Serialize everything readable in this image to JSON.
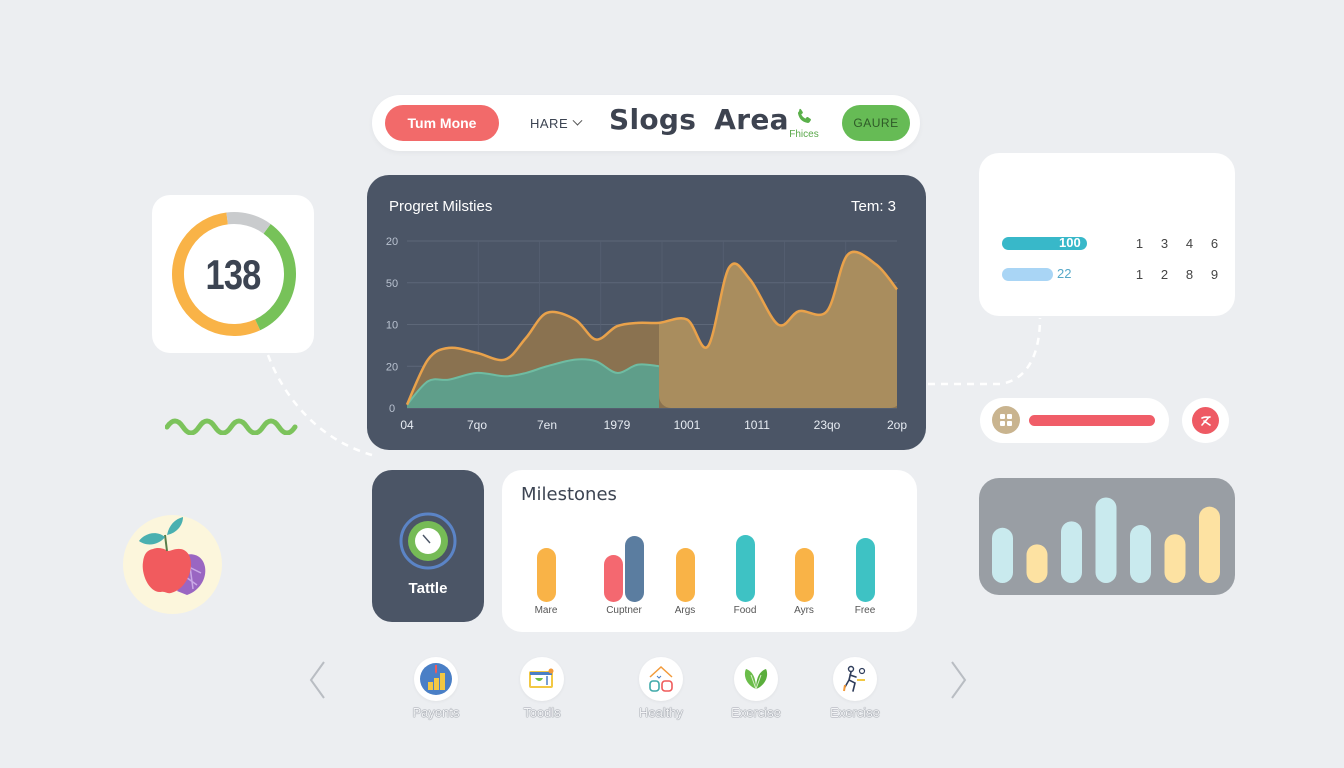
{
  "topbar": {
    "primary_button": "Tum Mone",
    "dropdown_label": "HARE",
    "title": "Slogs Area",
    "phone_label": "Fhices",
    "secondary_button": "GAURE"
  },
  "gauge": {
    "value": "138",
    "segments": [
      {
        "name": "orange",
        "fraction": 0.55,
        "color": "#f9b347"
      },
      {
        "name": "green",
        "fraction": 0.33,
        "color": "#77c259"
      },
      {
        "name": "gray",
        "fraction": 0.12,
        "color": "#c9cbcd"
      }
    ]
  },
  "main_chart": {
    "title": "Progret Milsties",
    "meta": "Tem: 3"
  },
  "chart_data": {
    "type": "area",
    "title": "Progret Milsties",
    "y_tick_labels": [
      "0",
      "20",
      "10",
      "50",
      "20"
    ],
    "x_tick_labels": [
      "04",
      "7qo",
      "7en",
      "1979",
      "1001",
      "1011",
      "23qo",
      "2op"
    ],
    "ylim": [
      0,
      100
    ],
    "grid": true,
    "series": [
      {
        "name": "orange",
        "color": "#e9a24b",
        "fill": "#8a7250",
        "x": [
          0,
          0.3,
          0.6,
          1.0,
          1.4,
          1.7,
          2.0,
          2.4,
          2.7,
          3.0,
          3.3,
          3.6,
          4.0,
          4.3,
          4.6,
          4.9,
          5.3,
          5.6,
          6.0,
          6.3,
          6.7,
          7.0
        ],
        "y": [
          2,
          29,
          36,
          33,
          29,
          42,
          57,
          53,
          41,
          49,
          51,
          51,
          53,
          37,
          84,
          77,
          50,
          58,
          58,
          92,
          86,
          71
        ]
      },
      {
        "name": "teal",
        "color": "#5fa88f",
        "fill": "#5f9e8a",
        "x": [
          0,
          0.3,
          0.6,
          1.0,
          1.4,
          1.7,
          2.0,
          2.4,
          2.7,
          3.0,
          3.3,
          3.6
        ],
        "y": [
          2,
          16,
          17,
          21,
          19,
          21,
          25,
          29,
          28,
          21,
          26,
          25
        ]
      }
    ],
    "highlight_region": {
      "from_x": 3.6,
      "to_x": 7.0,
      "fill": "#a98d5e"
    }
  },
  "info_card": {
    "pills": [
      {
        "value": "100",
        "fraction": 1.0,
        "color": "#38b8c9",
        "text_color": "#ffffff"
      },
      {
        "value": "22",
        "fraction": 0.6,
        "color": "#a9d5f5",
        "text_color": "#56a8c8"
      }
    ],
    "rows": [
      [
        "1",
        "3",
        "4",
        "6"
      ],
      [
        "1",
        "2",
        "8",
        "9"
      ]
    ]
  },
  "slider": {
    "value_fraction": 1.0,
    "track_color": "#f05d68"
  },
  "mini_bars": {
    "bars": [
      {
        "value": 0.6,
        "color": "#c9eaee"
      },
      {
        "value": 0.42,
        "color": "#fde2a2"
      },
      {
        "value": 0.67,
        "color": "#c9eaee"
      },
      {
        "value": 0.93,
        "color": "#c9eaee"
      },
      {
        "value": 0.63,
        "color": "#c9eaee"
      },
      {
        "value": 0.53,
        "color": "#fde2a2"
      },
      {
        "value": 0.83,
        "color": "#fde2a2"
      }
    ]
  },
  "tattle": {
    "label": "Tattle"
  },
  "milestones": {
    "title": "Milestones",
    "groups": [
      {
        "label": "Mare",
        "bars": [
          {
            "value": 0.66,
            "color": "#f9b347"
          }
        ]
      },
      {
        "label": "Cuptner",
        "bars": [
          {
            "value": 0.57,
            "color": "#f46870"
          },
          {
            "value": 0.8,
            "color": "#5b7da0"
          }
        ]
      },
      {
        "label": "Args",
        "bars": [
          {
            "value": 0.66,
            "color": "#f9b347"
          }
        ]
      },
      {
        "label": "Food",
        "bars": [
          {
            "value": 0.82,
            "color": "#3ec2c4"
          }
        ]
      },
      {
        "label": "Ayrs",
        "bars": [
          {
            "value": 0.66,
            "color": "#f9b347"
          }
        ]
      },
      {
        "label": "Free",
        "bars": [
          {
            "value": 0.78,
            "color": "#3ec2c4"
          }
        ]
      }
    ]
  },
  "bottom_nav": {
    "items": [
      {
        "label": "Payents",
        "icon": "payments-chart-icon"
      },
      {
        "label": "Toodls",
        "icon": "tools-board-icon"
      },
      {
        "label": "Healthy",
        "icon": "home-health-icon"
      },
      {
        "label": "Exercise",
        "icon": "leaf-exercise-icon"
      },
      {
        "label": "Exercise",
        "icon": "runner-exercise-icon"
      }
    ]
  }
}
